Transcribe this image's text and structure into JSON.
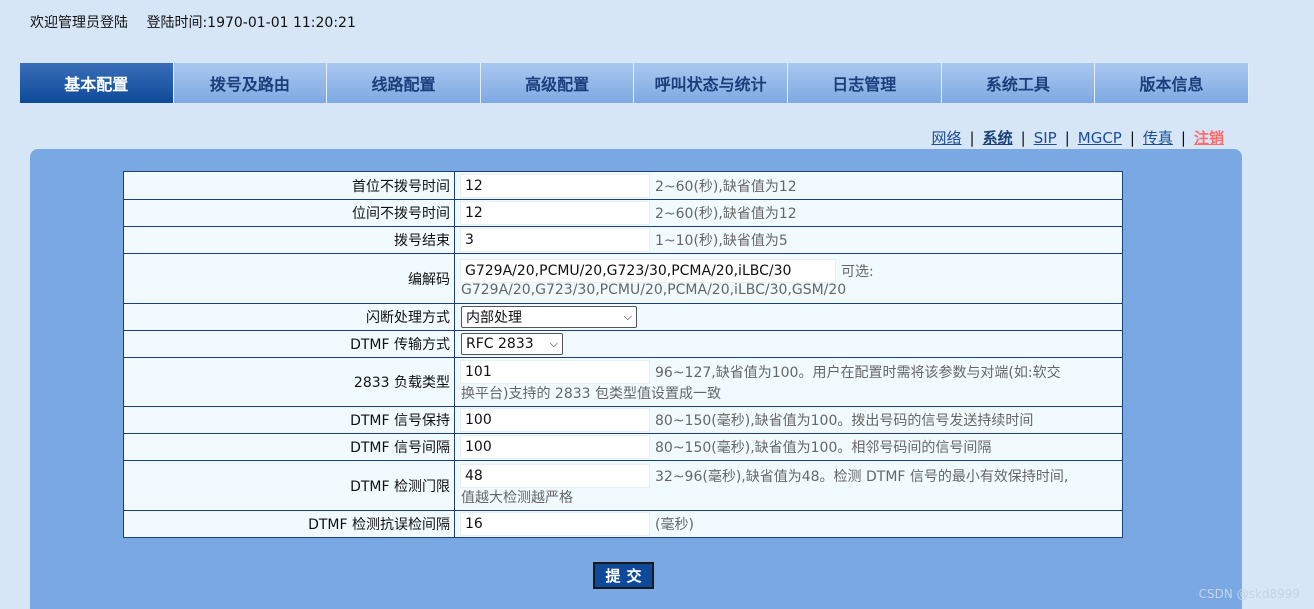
{
  "header": {
    "welcome": "欢迎管理员登陆",
    "login_time_label": "登陆时间:",
    "login_time": "1970-01-01 11:20:21"
  },
  "nav": {
    "items": [
      {
        "label": "基本配置"
      },
      {
        "label": "拨号及路由"
      },
      {
        "label": "线路配置"
      },
      {
        "label": "高级配置"
      },
      {
        "label": "呼叫状态与统计"
      },
      {
        "label": "日志管理"
      },
      {
        "label": "系统工具"
      },
      {
        "label": "版本信息"
      }
    ]
  },
  "subnav": {
    "items": [
      "网络",
      "系统",
      "SIP",
      "MGCP",
      "传真",
      "注销"
    ],
    "separator": "|"
  },
  "form": {
    "rows": [
      {
        "label": "首位不拨号时间",
        "value": "12",
        "hint": "2~60(秒),缺省值为12"
      },
      {
        "label": "位间不拨号时间",
        "value": "12",
        "hint": "2~60(秒),缺省值为12"
      },
      {
        "label": "拨号结束",
        "value": "3",
        "hint": "1~10(秒),缺省值为5"
      },
      {
        "label": "编解码",
        "value": "G729A/20,PCMU/20,G723/30,PCMA/20,iLBC/30",
        "hint": "可选:",
        "hint2": "G729A/20,G723/30,PCMU/20,PCMA/20,iLBC/30,GSM/20"
      },
      {
        "label": "闪断处理方式",
        "selected": "内部处理"
      },
      {
        "label": "DTMF 传输方式",
        "selected": "RFC 2833"
      },
      {
        "label": "2833 负载类型",
        "value": "101",
        "hint": "96~127,缺省值为100。用户在配置时需将该参数与对端(如:软交",
        "hint2": "换平台)支持的 2833 包类型值设置成一致"
      },
      {
        "label": "DTMF 信号保持",
        "value": "100",
        "hint": "80~150(毫秒),缺省值为100。拨出号码的信号发送持续时间"
      },
      {
        "label": "DTMF 信号间隔",
        "value": "100",
        "hint": "80~150(毫秒),缺省值为100。相邻号码间的信号间隔"
      },
      {
        "label": "DTMF 检测门限",
        "value": "48",
        "hint": "32~96(毫秒),缺省值为48。检测 DTMF 信号的最小有效保持时间,",
        "hint2": "值越大检测越严格"
      },
      {
        "label": "DTMF 检测抗误检间隔",
        "value": "16",
        "hint": "(毫秒)"
      }
    ]
  },
  "submit_label": "提交",
  "watermark": "CSDN @skd8999"
}
